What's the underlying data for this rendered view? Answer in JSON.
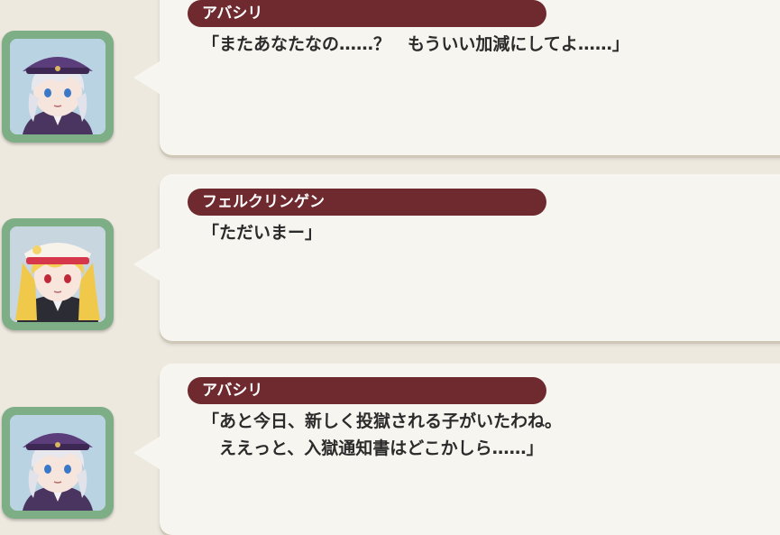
{
  "messages": [
    {
      "speaker": "アバシリ",
      "avatar_icon": "abashiri-portrait-icon",
      "lines": [
        "「またあなたなの……？　もういい加減にしてよ……」"
      ]
    },
    {
      "speaker": "フェルクリンゲン",
      "avatar_icon": "volklingen-portrait-icon",
      "lines": [
        "「ただいまー」"
      ]
    },
    {
      "speaker": "アバシリ",
      "avatar_icon": "abashiri-portrait-icon",
      "lines": [
        "「あと今日、新しく投獄される子がいたわね。",
        "　ええっと、入獄通知書はどこかしら……」"
      ]
    }
  ],
  "colors": {
    "background": "#eee9df",
    "bubble": "#f7f5ef",
    "name_pill": "#6e2a2f",
    "avatar_frame": "#7eae86"
  }
}
